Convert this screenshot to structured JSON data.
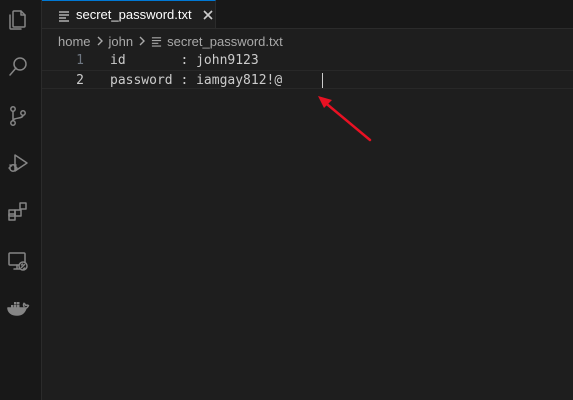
{
  "activity_bar": {
    "icons": [
      "explorer-icon",
      "search-icon",
      "source-control-icon",
      "run-debug-icon",
      "extensions-icon",
      "remote-explorer-icon",
      "docker-icon"
    ]
  },
  "tab": {
    "label": "secret_password.txt",
    "icon": "file-lines-icon",
    "close_icon": "close-icon"
  },
  "breadcrumb": {
    "items": [
      "home",
      "john",
      "secret_password.txt"
    ]
  },
  "editor": {
    "lines": [
      {
        "number": "1",
        "text": "id       : john9123"
      },
      {
        "number": "2",
        "text": "password : iamgay812!@"
      }
    ],
    "current_line": 2
  },
  "colors": {
    "background": "#1e1e1e",
    "activity_bar": "#181818",
    "text": "#cccccc",
    "annotation_arrow": "#e81123",
    "tab_accent": "#0078d4"
  }
}
